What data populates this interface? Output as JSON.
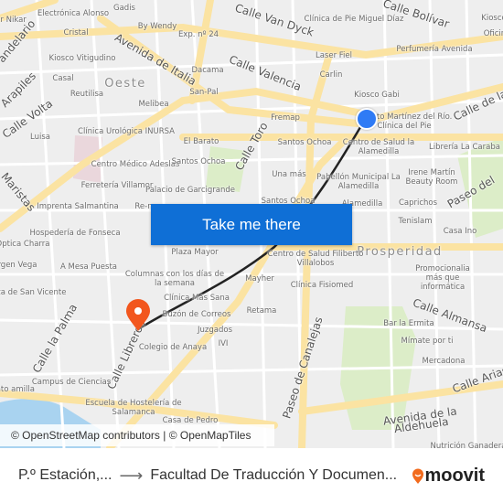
{
  "map": {
    "labels": [
      "Calle Van Dyck",
      "Calle Bolívar",
      "Avenida de Italia",
      "Calle Valencia",
      "Calle Toro",
      "Calle de la",
      "Paseo del",
      "Calle Almansa",
      "Calle Arias",
      "Avenida de la Aldehuela",
      "Paseo de Canalejas",
      "Calle la Palma",
      "Calle Libreros",
      "Calle Volta",
      "Arapiles",
      "andelario",
      "Maristas",
      "Oeste",
      "Prosperidad",
      "Gadis",
      "Electrónica Alonso",
      "ar Nikar",
      "Cristal",
      "By Wendy",
      "Exp. nº 24",
      "Kiosco Vitigudino",
      "Dacama",
      "Casal",
      "Reutilisa",
      "San-Pal",
      "Melibea",
      "Clínica Urológica INURSA",
      "Luisa",
      "El Barato",
      "Centro Médico Adeslas",
      "Santos Ochoa",
      "Ferretería Villamor",
      "Palacio de Garcigrande",
      "Imprenta Salmantina",
      "Re-n",
      "Hospedería de Fonseca",
      "Óptica Charra",
      "Virgen Vega",
      "A Mesa Puesta",
      "Plaza de San Vicente",
      "Plaza Mayor",
      "Columnas con los días de la semana",
      "Clínica Más Sana",
      "Buzón de Correos",
      "Juzgados",
      "IVI",
      "Colegio de Anaya",
      "Campus de Ciencias",
      "mento amilla",
      "Escuela de Hostelería de Salamanca",
      "Casa de Pedro",
      "Clínica de Pie Miguel Díaz",
      "Kiosco",
      "Oficir",
      "Laser Fiel",
      "Perfumería Avenida",
      "Carlin",
      "Kiosco Gabi",
      "Fremap",
      "Alberto Martínez del Río. Clínica del Pie",
      "Santos Ochoa",
      "Centro de Salud la Alamedilla",
      "Librería La Caraba",
      "Una más",
      "Pabellón Municipal La Alamedilla",
      "Irene Martín Beauty Room",
      "Santos Ochoa",
      "Alamedilla",
      "Caprichos",
      "Tenislam",
      "Casa Ino",
      "Centro de Salud Filiberto Villalobos",
      "Mayher",
      "Clínica Fisiomed",
      "Promocionalia más que informática",
      "Retama",
      "Bar la Ermita",
      "Mímate por ti",
      "Mercadona",
      "Nutrición Ganadera"
    ],
    "take_me_there": "Take me there",
    "attribution": "© OpenStreetMap contributors | © OpenMapTiles",
    "origin_color": "#2f7bf5",
    "destination_color": "#f2561d",
    "route_color": "#222222",
    "cta_color": "#0f6fd6"
  },
  "footer": {
    "from": "P.º Estación,...",
    "arrow_icon": "arrow-right-icon",
    "to": "Facultad De Traducción Y Documen...",
    "brand": "moovit",
    "brand_color": "#f26b1d"
  }
}
